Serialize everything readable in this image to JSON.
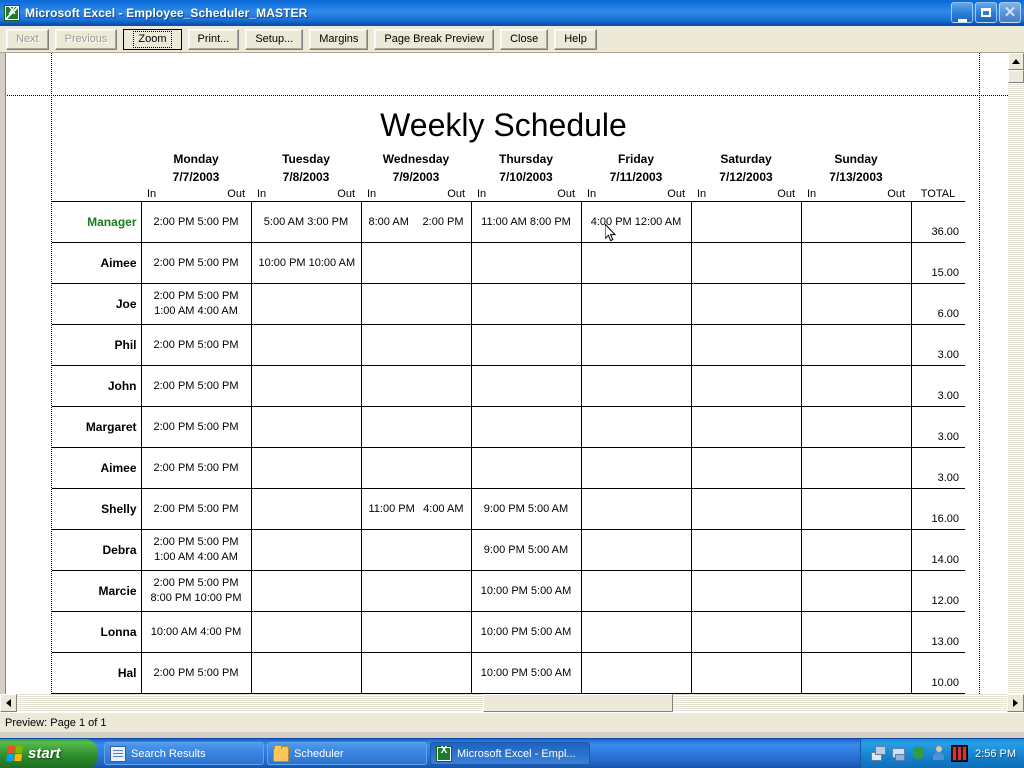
{
  "window": {
    "title": "Microsoft Excel - Employee_Scheduler_MASTER",
    "icon": "excel-icon",
    "minimize_label": "Minimize",
    "maximize_label": "Restore",
    "close_label": "Close"
  },
  "toolbar": {
    "buttons": [
      {
        "label": "Next",
        "disabled": true,
        "focused": false
      },
      {
        "label": "Previous",
        "disabled": true,
        "focused": false
      },
      {
        "label": "Zoom",
        "disabled": false,
        "focused": true
      },
      {
        "label": "Print...",
        "disabled": false,
        "focused": false
      },
      {
        "label": "Setup...",
        "disabled": false,
        "focused": false
      },
      {
        "label": "Margins",
        "disabled": false,
        "focused": false
      },
      {
        "label": "Page Break Preview",
        "disabled": false,
        "focused": false
      },
      {
        "label": "Close",
        "disabled": false,
        "focused": false
      },
      {
        "label": "Help",
        "disabled": false,
        "focused": false
      }
    ]
  },
  "sheet": {
    "title": "Weekly Schedule",
    "total_header": "TOTAL",
    "in_label": "In",
    "out_label": "Out",
    "days": [
      {
        "name": "Monday",
        "date": "7/7/2003"
      },
      {
        "name": "Tuesday",
        "date": "7/8/2003"
      },
      {
        "name": "Wednesday",
        "date": "7/9/2003"
      },
      {
        "name": "Thursday",
        "date": "7/10/2003"
      },
      {
        "name": "Friday",
        "date": "7/11/2003"
      },
      {
        "name": "Saturday",
        "date": "7/12/2003"
      },
      {
        "name": "Sunday",
        "date": "7/13/2003"
      }
    ],
    "manager_color": "#1a7a1a",
    "rows": [
      {
        "name": "Manager",
        "is_manager": true,
        "total": "36.00",
        "cells": [
          [
            "2:00 PM 5:00 PM"
          ],
          [
            "5:00 AM 3:00 PM"
          ],
          [
            "8:00 AM|2:00 PM"
          ],
          [
            "11:00 AM 8:00 PM"
          ],
          [
            "4:00 PM 12:00 AM"
          ],
          [],
          []
        ]
      },
      {
        "name": "Aimee",
        "is_manager": false,
        "total": "15.00",
        "cells": [
          [
            "2:00 PM 5:00 PM"
          ],
          [
            "10:00 PM 10:00 AM"
          ],
          [],
          [],
          [],
          [],
          []
        ]
      },
      {
        "name": "Joe",
        "is_manager": false,
        "total": "6.00",
        "cells": [
          [
            "2:00 PM 5:00 PM",
            "1:00 AM 4:00 AM"
          ],
          [],
          [],
          [],
          [],
          [],
          []
        ]
      },
      {
        "name": "Phil",
        "is_manager": false,
        "total": "3.00",
        "cells": [
          [
            "2:00 PM 5:00 PM"
          ],
          [],
          [],
          [],
          [],
          [],
          []
        ]
      },
      {
        "name": "John",
        "is_manager": false,
        "total": "3.00",
        "cells": [
          [
            "2:00 PM 5:00 PM"
          ],
          [],
          [],
          [],
          [],
          [],
          []
        ]
      },
      {
        "name": "Margaret",
        "is_manager": false,
        "total": "3.00",
        "cells": [
          [
            "2:00 PM 5:00 PM"
          ],
          [],
          [],
          [],
          [],
          [],
          []
        ]
      },
      {
        "name": "Aimee",
        "is_manager": false,
        "total": "3.00",
        "cells": [
          [
            "2:00 PM 5:00 PM"
          ],
          [],
          [],
          [],
          [],
          [],
          []
        ]
      },
      {
        "name": "Shelly",
        "is_manager": false,
        "total": "16.00",
        "cells": [
          [
            "2:00 PM 5:00 PM"
          ],
          [],
          [
            "11:00 PM|4:00 AM"
          ],
          [
            "9:00 PM 5:00 AM"
          ],
          [],
          [],
          []
        ]
      },
      {
        "name": "Debra",
        "is_manager": false,
        "total": "14.00",
        "cells": [
          [
            "2:00 PM 5:00 PM",
            "1:00 AM 4:00 AM"
          ],
          [],
          [],
          [
            "9:00 PM 5:00 AM"
          ],
          [],
          [],
          []
        ]
      },
      {
        "name": "Marcie",
        "is_manager": false,
        "total": "12.00",
        "cells": [
          [
            "2:00 PM 5:00 PM",
            "8:00 PM 10:00 PM"
          ],
          [],
          [],
          [
            "10:00 PM 5:00 AM"
          ],
          [],
          [],
          []
        ]
      },
      {
        "name": "Lonna",
        "is_manager": false,
        "total": "13.00",
        "cells": [
          [
            "10:00 AM 4:00 PM"
          ],
          [],
          [],
          [
            "10:00 PM 5:00 AM"
          ],
          [],
          [],
          []
        ]
      },
      {
        "name": "Hal",
        "is_manager": false,
        "total": "10.00",
        "cells": [
          [
            "2:00 PM 5:00 PM"
          ],
          [],
          [],
          [
            "10:00 PM 5:00 AM"
          ],
          [],
          [],
          []
        ]
      }
    ]
  },
  "statusbar": {
    "text": "Preview: Page 1 of 1"
  },
  "taskbar": {
    "start_label": "start",
    "items": [
      {
        "label": "Search Results",
        "icon": "document-icon",
        "active": false
      },
      {
        "label": "Scheduler",
        "icon": "folder-icon",
        "active": false
      },
      {
        "label": "Microsoft Excel - Empl...",
        "icon": "excel-icon",
        "active": true
      }
    ],
    "tray_icons": [
      "network-icon",
      "network-connection-icon",
      "shield-icon",
      "user-account-icon",
      "volume-meter-icon"
    ],
    "clock": "2:56 PM"
  }
}
